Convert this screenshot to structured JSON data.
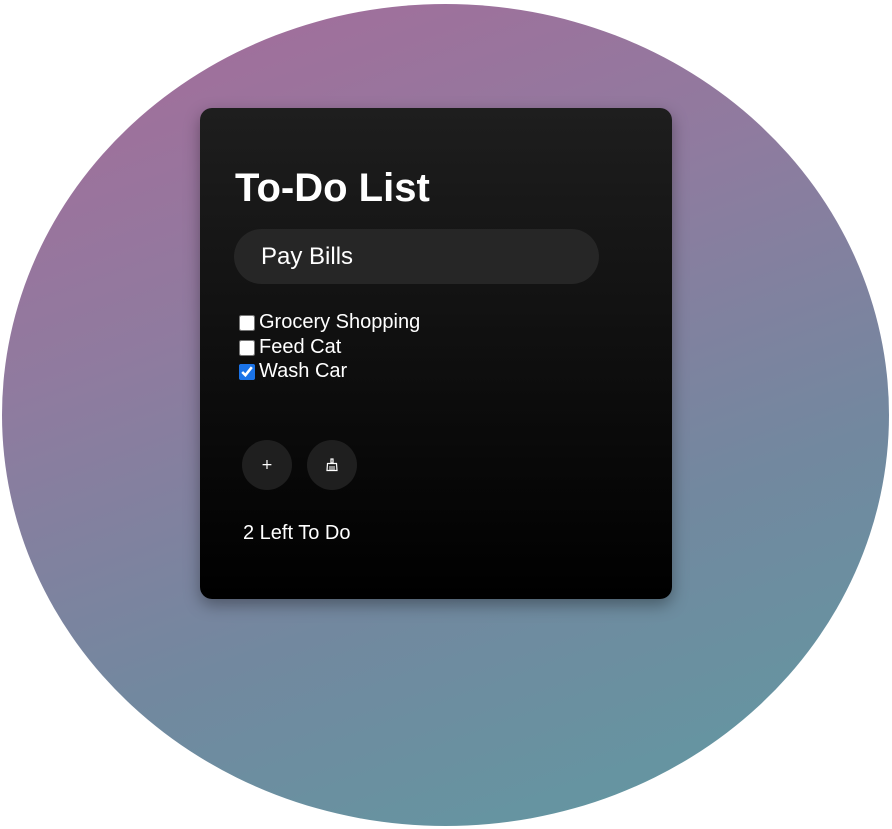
{
  "app": {
    "title": "To-Do List"
  },
  "task_input": {
    "value": "Pay Bills",
    "placeholder": ""
  },
  "tasks": [
    {
      "label": "Grocery Shopping",
      "checked": false
    },
    {
      "label": "Feed Cat",
      "checked": false
    },
    {
      "label": "Wash Car",
      "checked": true
    }
  ],
  "buttons": {
    "add_label": "+",
    "add_icon": "plus-icon",
    "clear_icon": "broom-icon"
  },
  "status": {
    "remaining_text": "2 Left To Do"
  },
  "colors": {
    "checkbox_accent": "#1a73e8",
    "card_top": "#1e1e1e",
    "card_bottom": "#000000",
    "gradient_start": "#a76b9a",
    "gradient_end": "#5f9ba2"
  }
}
